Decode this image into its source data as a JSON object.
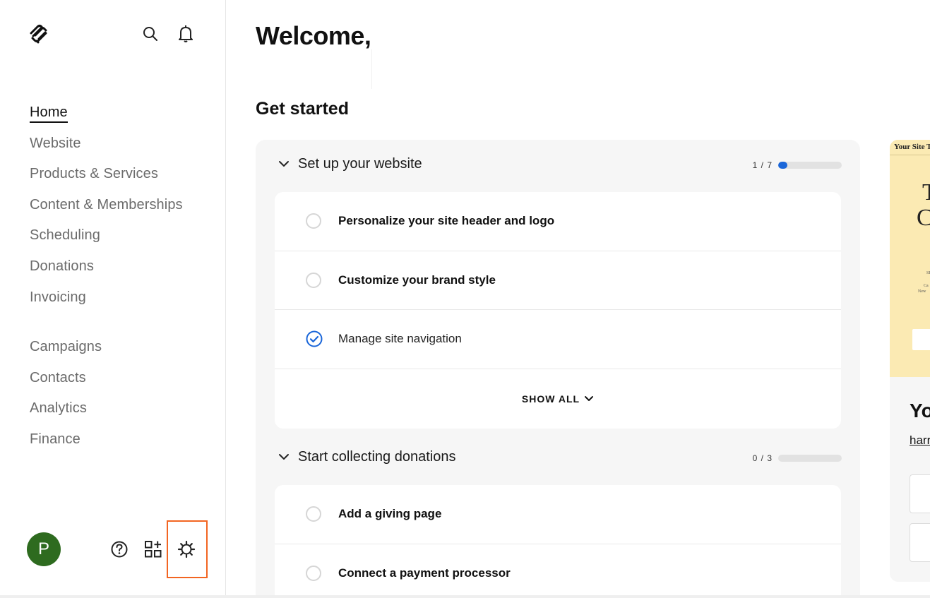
{
  "sidebar": {
    "primary_nav": [
      {
        "label": "Home",
        "active": true
      },
      {
        "label": "Website"
      },
      {
        "label": "Products & Services"
      },
      {
        "label": "Content & Memberships"
      },
      {
        "label": "Scheduling"
      },
      {
        "label": "Donations"
      },
      {
        "label": "Invoicing"
      }
    ],
    "secondary_nav": [
      {
        "label": "Campaigns"
      },
      {
        "label": "Contacts"
      },
      {
        "label": "Analytics"
      },
      {
        "label": "Finance"
      }
    ],
    "avatar_initial": "P",
    "avatar_color": "#2e6b1f",
    "top_icons": [
      "squarespace-logo",
      "search-icon",
      "bell-icon"
    ],
    "bottom_icons": [
      "help-icon",
      "apps-icon",
      "settings-icon"
    ],
    "highlight_color": "#f26522"
  },
  "main": {
    "welcome": "Welcome,",
    "get_started": "Get started",
    "sections": [
      {
        "title": "Set up your website",
        "progress_text": "1 / 7",
        "progress_fraction": 0.1429,
        "tasks": [
          {
            "label": "Personalize your site header and logo",
            "done": false
          },
          {
            "label": "Customize your brand style",
            "done": false
          },
          {
            "label": "Manage site navigation",
            "done": true
          }
        ],
        "show_all": "SHOW ALL"
      },
      {
        "title": "Start collecting donations",
        "progress_text": "0 / 3",
        "progress_fraction": 0,
        "tasks": [
          {
            "label": "Add a giving page",
            "done": false
          },
          {
            "label": "Connect a payment processor",
            "done": false
          }
        ]
      }
    ],
    "accent_color": "#1a66d9"
  },
  "preview": {
    "bar_text": "Your Site T",
    "big_text_1": "T",
    "big_text_2": "C",
    "small_1": "SE",
    "small_2": "Ca",
    "small_3": "New",
    "title": "Yo",
    "link": "harr",
    "background": "#fbeab3"
  }
}
